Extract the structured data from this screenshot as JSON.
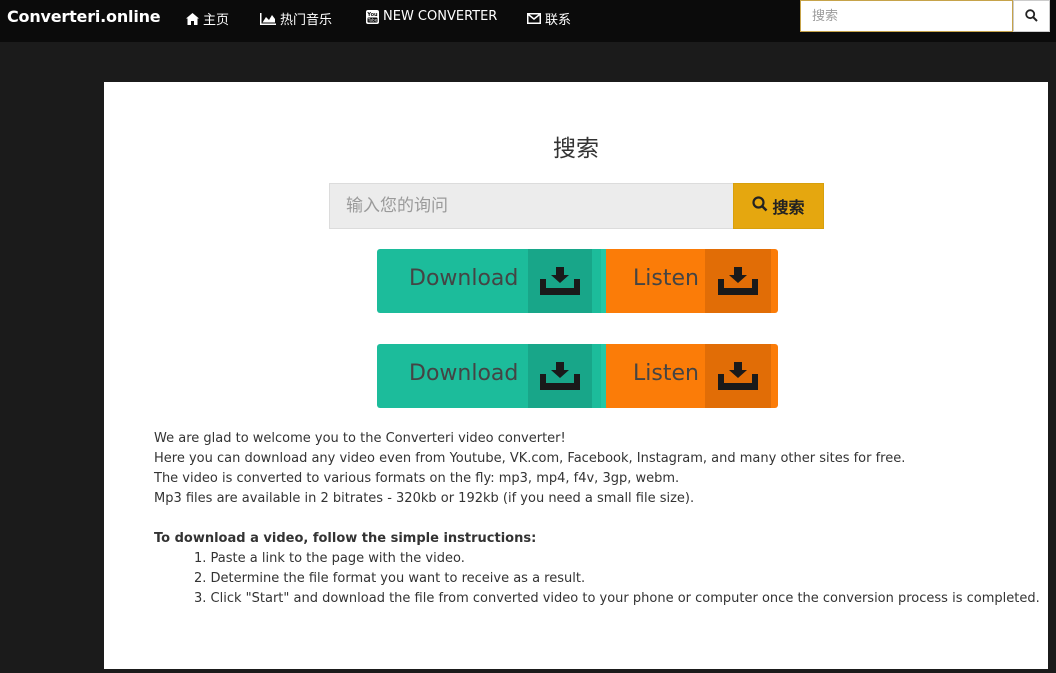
{
  "nav": {
    "brand": "Converteri.online",
    "items": [
      {
        "label": "主页",
        "icon": "home-icon"
      },
      {
        "label": "热门音乐",
        "icon": "area-chart-icon"
      },
      {
        "label": "NEW CONVERTER",
        "icon": "youtube-icon"
      },
      {
        "label": "联系",
        "icon": "envelope-icon"
      }
    ],
    "search_placeholder": "搜索",
    "search_icon": "search-icon"
  },
  "main": {
    "title": "搜索",
    "search_placeholder": "输入您的询问",
    "search_button": "搜索",
    "rows": [
      {
        "download": "Download",
        "listen": "Listen"
      },
      {
        "download": "Download",
        "listen": "Listen"
      }
    ]
  },
  "description": {
    "lines": [
      "We are glad to welcome you to the Converteri video converter!",
      "Here you can download any video even from Youtube, VK.com, Facebook, Instagram, and many other sites for free.",
      "The video is converted to various formats on the fly: mp3, mp4, f4v, 3gp, webm.",
      "Mp3 files are available in 2 bitrates - 320kb or 192kb (if you need a small file size)."
    ],
    "instructions_title": "To download a video, follow the simple instructions:",
    "steps": [
      "1. Paste a link to the page with the video.",
      "2. Determine the file format you want to receive as a result.",
      "3. Click \"Start\" and download the file from converted video to your phone or computer once the conversion process is completed."
    ]
  },
  "colors": {
    "download": "#1cbc9b",
    "download_icon_bg": "#18a689",
    "listen": "#fb7c08",
    "listen_icon_bg": "#e16d06",
    "search_button": "#e5a70f",
    "navbar": "#0b0b0b"
  }
}
